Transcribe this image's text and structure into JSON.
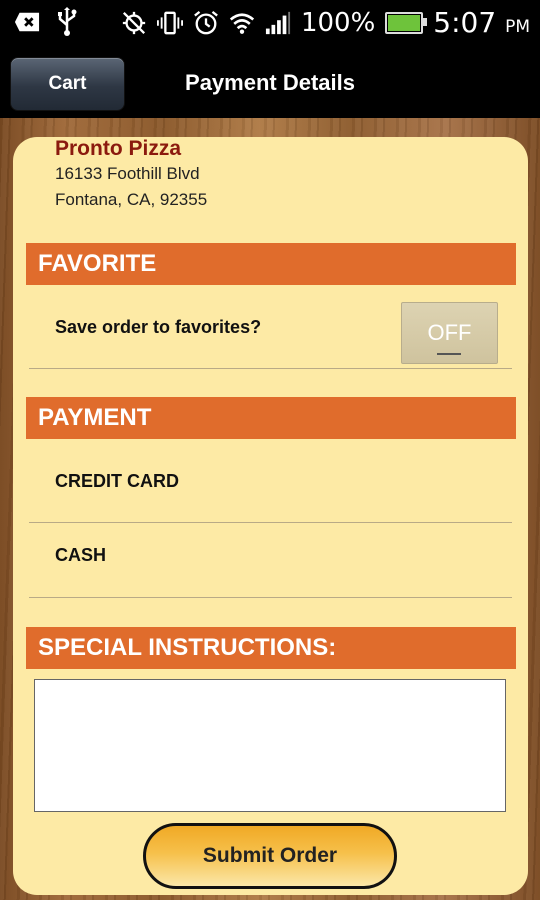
{
  "status_bar": {
    "battery_text": "100%",
    "time": "5:07",
    "ampm": "PM",
    "battery_level": 1.0,
    "icons": [
      "message-icon",
      "usb-icon",
      "location-off-icon",
      "vibrate-icon",
      "alarm-icon",
      "wifi-icon",
      "signal-icon",
      "battery-icon"
    ]
  },
  "titlebar": {
    "back_label": "Cart",
    "title": "Payment Details"
  },
  "restaurant": {
    "name": "Pronto Pizza",
    "address_line1": "16133 Foothill Blvd",
    "address_line2": "Fontana, CA, 92355"
  },
  "favorite": {
    "header": "FAVORITE",
    "label": "Save order to favorites?",
    "toggle_state": "OFF"
  },
  "payment": {
    "header": "PAYMENT",
    "options": [
      "CREDIT CARD",
      "CASH"
    ]
  },
  "instructions": {
    "header": "SPECIAL INSTRUCTIONS:",
    "value": ""
  },
  "submit_label": "Submit Order",
  "colors": {
    "section_header": "#e06c2c",
    "card_bg": "#fdeaa5",
    "restaurant_name": "#8b1a0e"
  }
}
